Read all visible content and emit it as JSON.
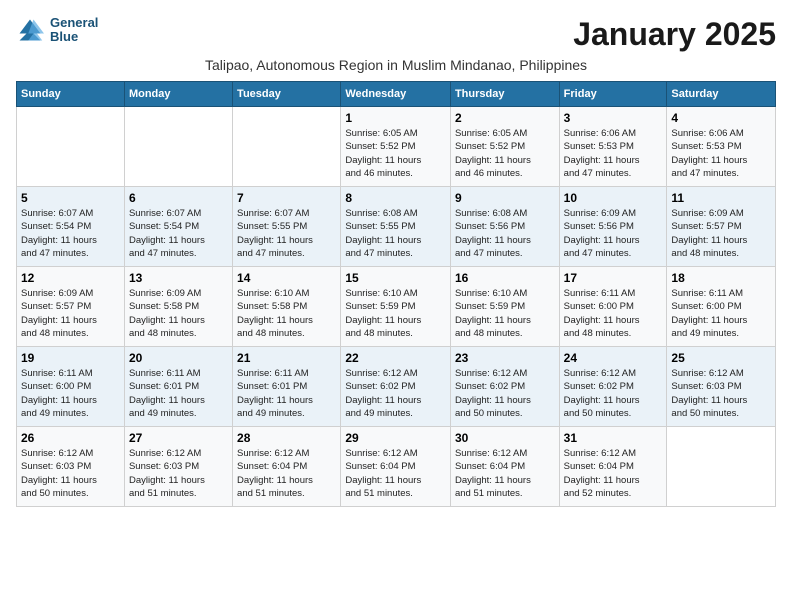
{
  "logo": {
    "line1": "General",
    "line2": "Blue"
  },
  "title": "January 2025",
  "subtitle": "Talipao, Autonomous Region in Muslim Mindanao, Philippines",
  "weekdays": [
    "Sunday",
    "Monday",
    "Tuesday",
    "Wednesday",
    "Thursday",
    "Friday",
    "Saturday"
  ],
  "weeks": [
    [
      {
        "day": "",
        "info": ""
      },
      {
        "day": "",
        "info": ""
      },
      {
        "day": "",
        "info": ""
      },
      {
        "day": "1",
        "info": "Sunrise: 6:05 AM\nSunset: 5:52 PM\nDaylight: 11 hours\nand 46 minutes."
      },
      {
        "day": "2",
        "info": "Sunrise: 6:05 AM\nSunset: 5:52 PM\nDaylight: 11 hours\nand 46 minutes."
      },
      {
        "day": "3",
        "info": "Sunrise: 6:06 AM\nSunset: 5:53 PM\nDaylight: 11 hours\nand 47 minutes."
      },
      {
        "day": "4",
        "info": "Sunrise: 6:06 AM\nSunset: 5:53 PM\nDaylight: 11 hours\nand 47 minutes."
      }
    ],
    [
      {
        "day": "5",
        "info": "Sunrise: 6:07 AM\nSunset: 5:54 PM\nDaylight: 11 hours\nand 47 minutes."
      },
      {
        "day": "6",
        "info": "Sunrise: 6:07 AM\nSunset: 5:54 PM\nDaylight: 11 hours\nand 47 minutes."
      },
      {
        "day": "7",
        "info": "Sunrise: 6:07 AM\nSunset: 5:55 PM\nDaylight: 11 hours\nand 47 minutes."
      },
      {
        "day": "8",
        "info": "Sunrise: 6:08 AM\nSunset: 5:55 PM\nDaylight: 11 hours\nand 47 minutes."
      },
      {
        "day": "9",
        "info": "Sunrise: 6:08 AM\nSunset: 5:56 PM\nDaylight: 11 hours\nand 47 minutes."
      },
      {
        "day": "10",
        "info": "Sunrise: 6:09 AM\nSunset: 5:56 PM\nDaylight: 11 hours\nand 47 minutes."
      },
      {
        "day": "11",
        "info": "Sunrise: 6:09 AM\nSunset: 5:57 PM\nDaylight: 11 hours\nand 48 minutes."
      }
    ],
    [
      {
        "day": "12",
        "info": "Sunrise: 6:09 AM\nSunset: 5:57 PM\nDaylight: 11 hours\nand 48 minutes."
      },
      {
        "day": "13",
        "info": "Sunrise: 6:09 AM\nSunset: 5:58 PM\nDaylight: 11 hours\nand 48 minutes."
      },
      {
        "day": "14",
        "info": "Sunrise: 6:10 AM\nSunset: 5:58 PM\nDaylight: 11 hours\nand 48 minutes."
      },
      {
        "day": "15",
        "info": "Sunrise: 6:10 AM\nSunset: 5:59 PM\nDaylight: 11 hours\nand 48 minutes."
      },
      {
        "day": "16",
        "info": "Sunrise: 6:10 AM\nSunset: 5:59 PM\nDaylight: 11 hours\nand 48 minutes."
      },
      {
        "day": "17",
        "info": "Sunrise: 6:11 AM\nSunset: 6:00 PM\nDaylight: 11 hours\nand 48 minutes."
      },
      {
        "day": "18",
        "info": "Sunrise: 6:11 AM\nSunset: 6:00 PM\nDaylight: 11 hours\nand 49 minutes."
      }
    ],
    [
      {
        "day": "19",
        "info": "Sunrise: 6:11 AM\nSunset: 6:00 PM\nDaylight: 11 hours\nand 49 minutes."
      },
      {
        "day": "20",
        "info": "Sunrise: 6:11 AM\nSunset: 6:01 PM\nDaylight: 11 hours\nand 49 minutes."
      },
      {
        "day": "21",
        "info": "Sunrise: 6:11 AM\nSunset: 6:01 PM\nDaylight: 11 hours\nand 49 minutes."
      },
      {
        "day": "22",
        "info": "Sunrise: 6:12 AM\nSunset: 6:02 PM\nDaylight: 11 hours\nand 49 minutes."
      },
      {
        "day": "23",
        "info": "Sunrise: 6:12 AM\nSunset: 6:02 PM\nDaylight: 11 hours\nand 50 minutes."
      },
      {
        "day": "24",
        "info": "Sunrise: 6:12 AM\nSunset: 6:02 PM\nDaylight: 11 hours\nand 50 minutes."
      },
      {
        "day": "25",
        "info": "Sunrise: 6:12 AM\nSunset: 6:03 PM\nDaylight: 11 hours\nand 50 minutes."
      }
    ],
    [
      {
        "day": "26",
        "info": "Sunrise: 6:12 AM\nSunset: 6:03 PM\nDaylight: 11 hours\nand 50 minutes."
      },
      {
        "day": "27",
        "info": "Sunrise: 6:12 AM\nSunset: 6:03 PM\nDaylight: 11 hours\nand 51 minutes."
      },
      {
        "day": "28",
        "info": "Sunrise: 6:12 AM\nSunset: 6:04 PM\nDaylight: 11 hours\nand 51 minutes."
      },
      {
        "day": "29",
        "info": "Sunrise: 6:12 AM\nSunset: 6:04 PM\nDaylight: 11 hours\nand 51 minutes."
      },
      {
        "day": "30",
        "info": "Sunrise: 6:12 AM\nSunset: 6:04 PM\nDaylight: 11 hours\nand 51 minutes."
      },
      {
        "day": "31",
        "info": "Sunrise: 6:12 AM\nSunset: 6:04 PM\nDaylight: 11 hours\nand 52 minutes."
      },
      {
        "day": "",
        "info": ""
      }
    ]
  ]
}
